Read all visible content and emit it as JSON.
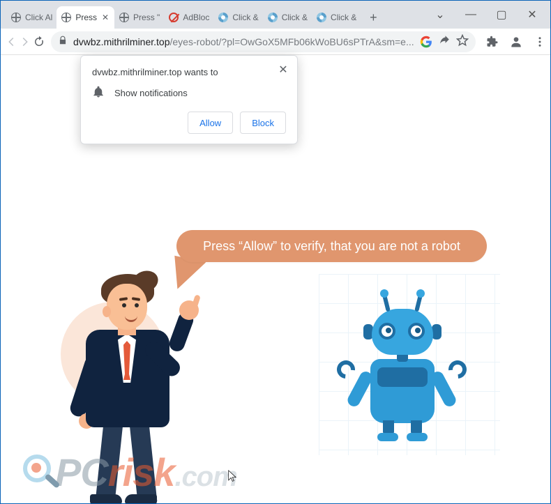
{
  "colors": {
    "accent": "#1a73e8",
    "speech_bg": "#e0966e",
    "robot_primary": "#2f9bd6",
    "robot_dark": "#1f6ea3"
  },
  "titlebar": {
    "tabs": [
      {
        "title": "Click Al",
        "favicon": "globe",
        "active": false
      },
      {
        "title": "Press",
        "favicon": "globe",
        "active": true
      },
      {
        "title": "Press \"",
        "favicon": "globe",
        "active": false
      },
      {
        "title": "AdBloc",
        "favicon": "nosign",
        "active": false
      },
      {
        "title": "Click &",
        "favicon": "gear",
        "active": false
      },
      {
        "title": "Click &",
        "favicon": "gear",
        "active": false
      },
      {
        "title": "Click &",
        "favicon": "gear",
        "active": false
      }
    ],
    "new_tab_tooltip": "+"
  },
  "window_controls": {
    "dropdown": "⌄",
    "minimize": "—",
    "maximize": "▢",
    "close": "✕"
  },
  "toolbar": {
    "url_domain": "dvwbz.mithrilminer.top",
    "url_path": "/eyes-robot/?pl=OwGoX5MFb06kWoBU6sPTrA&sm=e..."
  },
  "permission": {
    "origin_line": "dvwbz.mithrilminer.top wants to",
    "capability": "Show notifications",
    "allow": "Allow",
    "block": "Block"
  },
  "page": {
    "speech_text": "Press “Allow” to verify, that you are not a robot"
  },
  "watermark": {
    "pc": "PC",
    "risk": "risk",
    "com": ".com"
  }
}
